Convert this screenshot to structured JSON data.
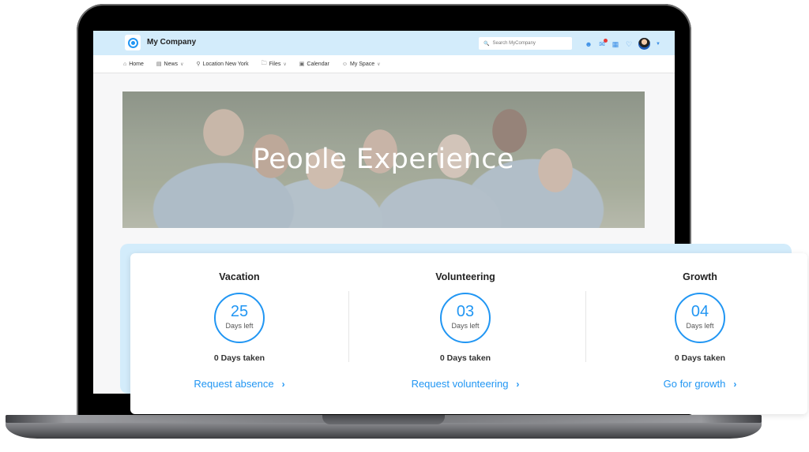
{
  "header": {
    "brand": "My Company",
    "search_placeholder": "Search MyCompany",
    "icons": [
      "community-icon",
      "chat-icon",
      "apps-grid-icon",
      "bell-icon",
      "avatar"
    ]
  },
  "nav": {
    "items": [
      {
        "label": "Home",
        "icon": "home-icon",
        "dropdown": false
      },
      {
        "label": "News",
        "icon": "news-icon",
        "dropdown": true
      },
      {
        "label": "Location New York",
        "icon": "location-icon",
        "dropdown": false
      },
      {
        "label": "Files",
        "icon": "folder-icon",
        "dropdown": true
      },
      {
        "label": "Calendar",
        "icon": "calendar-icon",
        "dropdown": false
      },
      {
        "label": "My Space",
        "icon": "person-icon",
        "dropdown": true
      }
    ]
  },
  "banner": {
    "title": "People Experience"
  },
  "cards": [
    {
      "title": "Vacation",
      "days_left": "25",
      "days_left_label": "Days left",
      "taken": "0 Days taken",
      "action": "Request absence"
    },
    {
      "title": "Volunteering",
      "days_left": "03",
      "days_left_label": "Days left",
      "taken": "0 Days taken",
      "action": "Request volunteering"
    },
    {
      "title": "Growth",
      "days_left": "04",
      "days_left_label": "Days left",
      "taken": "0 Days taken",
      "action": "Go for growth"
    }
  ],
  "colors": {
    "accent": "#2196f3",
    "header_bg": "#d3ecfb",
    "notification": "#e53935"
  }
}
